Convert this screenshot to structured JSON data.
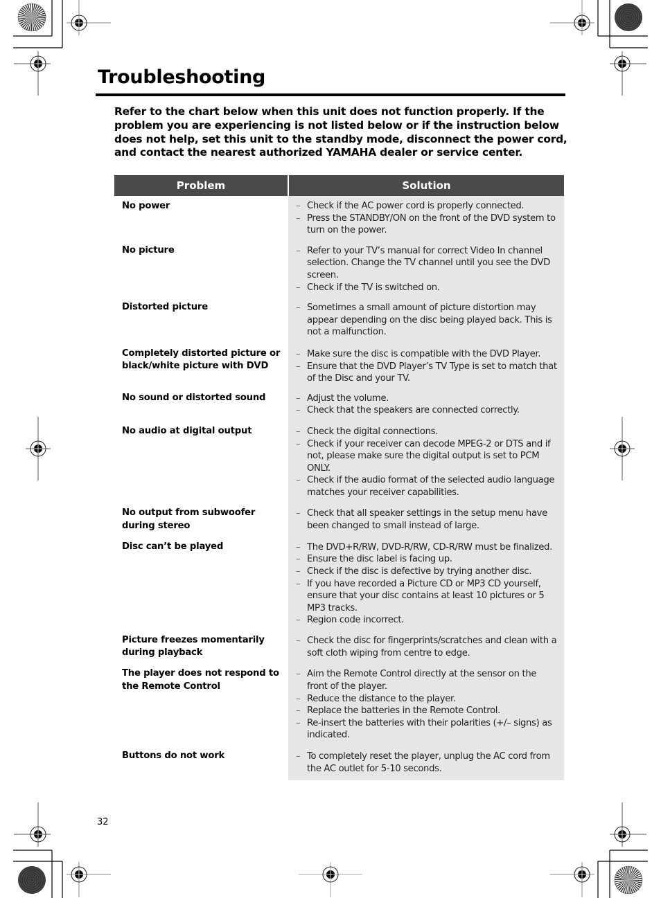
{
  "page": {
    "title": "Troubleshooting",
    "intro": "Refer to the chart below when this unit does not function properly. If the problem you are experiencing is not listed below or if the instruction below does not help, set this unit to the standby mode, disconnect the power cord, and contact the nearest authorized YAMAHA dealer or service center.",
    "page_number": "32"
  },
  "table": {
    "headers": {
      "problem": "Problem",
      "solution": "Solution"
    },
    "header_color": "#4a4a4a",
    "solution_bg": "#e6e6e6",
    "rows": [
      {
        "problem": "No power",
        "solutions": [
          "Check if the AC power cord is properly connected.",
          "Press the STANDBY/ON on the front of the DVD system to turn on the power."
        ]
      },
      {
        "problem": "No picture",
        "solutions": [
          "Refer to your TV’s manual for correct Video In channel selection. Change the TV channel until you see the DVD screen.",
          "Check if the TV is switched on."
        ]
      },
      {
        "problem": "Distorted picture",
        "solutions": [
          "Sometimes a small amount of picture distortion may appear depending on the disc being played back. This is not a malfunction."
        ]
      },
      {
        "problem": "Completely distorted picture or black/white picture with DVD",
        "solutions": [
          "Make sure the disc is compatible with the DVD Player.",
          "Ensure that the DVD Player’s TV Type is set to match that of the Disc and your TV."
        ]
      },
      {
        "problem": "No sound or distorted sound",
        "solutions": [
          "Adjust the volume.",
          "Check that the speakers are connected correctly."
        ]
      },
      {
        "problem": "No audio at digital output",
        "solutions": [
          "Check the digital connections.",
          "Check if your receiver can decode MPEG-2 or DTS and if not, please make sure the digital output is set to PCM ONLY.",
          "Check if the audio format of the selected audio language matches your receiver capabilities."
        ]
      },
      {
        "problem": "No output from subwoofer during stereo",
        "solutions": [
          "Check that all speaker settings in the setup menu have been changed to small instead of large."
        ]
      },
      {
        "problem": "Disc can’t be played",
        "solutions": [
          "The DVD+R/RW, DVD-R/RW, CD-R/RW must be finalized.",
          "Ensure the disc label is facing up.",
          "Check if the disc is defective by trying another disc.",
          "If you have recorded a Picture CD or MP3 CD yourself, ensure that your disc contains at least 10 pictures or 5 MP3 tracks.",
          "Region code incorrect."
        ]
      },
      {
        "problem": "Picture freezes momentarily during playback",
        "solutions": [
          "Check the disc for fingerprints/scratches and clean with a soft cloth wiping from centre to edge."
        ]
      },
      {
        "problem": "The player does not respond to the Remote Control",
        "solutions": [
          "Aim the Remote Control directly at the sensor on the front of the player.",
          "Reduce the distance to the player.",
          "Replace the batteries in the Remote Control.",
          "Re-insert the batteries with their polarities (+/– signs) as indicated."
        ]
      },
      {
        "problem": "Buttons do not work",
        "solutions": [
          "To completely reset the player, unplug the AC cord from the AC outlet for 5-10 seconds."
        ]
      }
    ]
  },
  "bullet_glyph": "–"
}
